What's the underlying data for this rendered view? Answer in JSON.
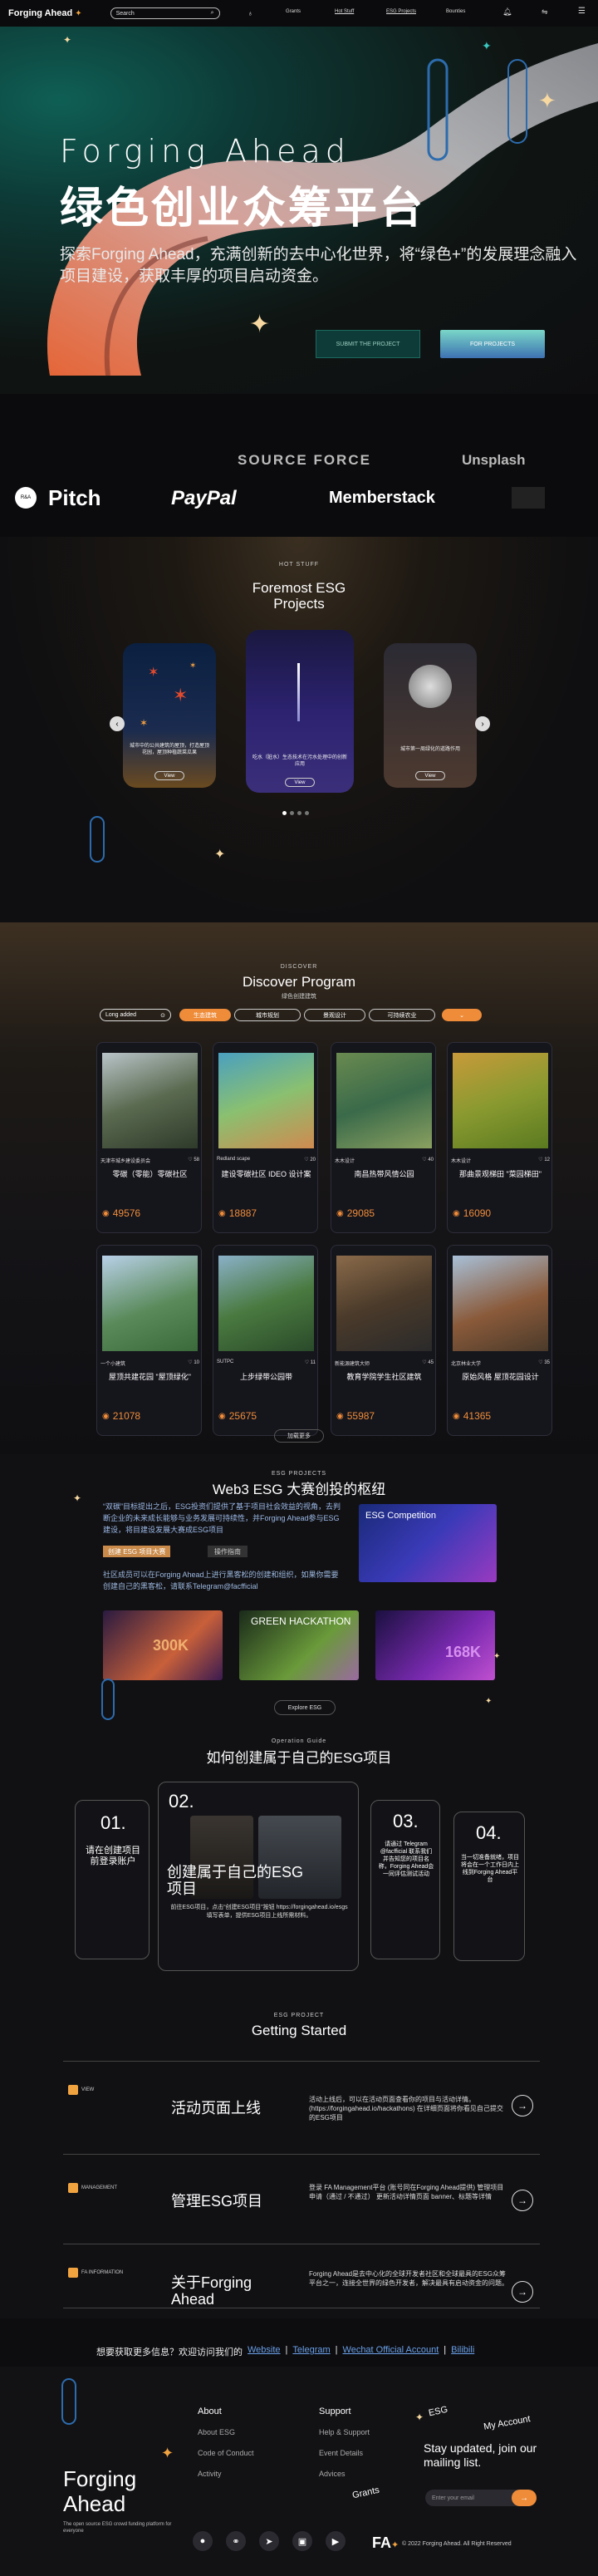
{
  "nav": {
    "logo": "Forging Ahead",
    "search_placeholder": "Search",
    "items": [
      "Grants",
      "Hot Stuff",
      "ESG Projects",
      "Bounties"
    ]
  },
  "hero": {
    "title_en": "Forging Ahead",
    "title_zh": "绿色创业众筹平台",
    "desc": "探索Forging Ahead，充满创新的去中心化世界，将“绿色+”的发展理念融入项目建设，获取丰厚的项目启动资金。",
    "btn_start": "SUBMIT THE PROJECT",
    "btn_second": "FOR PROJECTS"
  },
  "partners": {
    "row1": [
      "SOURCE FORCE",
      "Unsplash"
    ],
    "row2": [
      "Pitch",
      "PayPal",
      "Memberstack"
    ]
  },
  "hot": {
    "kicker": "HOT STUFF",
    "title": "Foremost ESG Projects",
    "cards": [
      {
        "desc": "城市中的公共建筑的屋顶，打造屋顶花园，屋顶种植蔬菜瓜果",
        "btn": "View"
      },
      {
        "desc": "吃水（脏水）生态技术在污水处理中的创新应用",
        "btn": "View"
      },
      {
        "desc": "城市第一周绿化的道路作用",
        "btn": "View"
      }
    ]
  },
  "discover": {
    "kicker": "DISCOVER",
    "title": "Discover Program",
    "subtitle": "绿色创建建筑",
    "sort": "Long added",
    "chips": [
      "生态建筑",
      "城市规划",
      "景观设计",
      "可持续农业"
    ],
    "projects": [
      {
        "author": "天津市城乡建设委员会",
        "likes": "58",
        "title": "零碳（零能）零碳社区",
        "views": "49576"
      },
      {
        "author": "Redland scape",
        "likes": "20",
        "title": "建设零碳社区 IDEO 设计案",
        "views": "18887"
      },
      {
        "author": "木木设计",
        "likes": "40",
        "title": "南昌热带风情公园",
        "views": "29085"
      },
      {
        "author": "木木设计",
        "likes": "12",
        "title": "那曲景观梯田 \"菜园梯田\"",
        "views": "16090"
      },
      {
        "author": "一个小建筑",
        "likes": "10",
        "title": "屋顶共建花园 \"屋顶绿化\"",
        "views": "21078"
      },
      {
        "author": "SUTPC",
        "likes": "11",
        "title": "上步绿带公园带",
        "views": "25675"
      },
      {
        "author": "新能源建筑大师",
        "likes": "45",
        "title": "教育学院学生社区建筑",
        "views": "55987"
      },
      {
        "author": "北京林业大学",
        "likes": "35",
        "title": "原始风格 屋顶花园设计",
        "views": "41365"
      }
    ],
    "more": "加载更多"
  },
  "esg": {
    "kicker": "ESG PROJECTS",
    "title": "Web3 ESG 大赛创投的枢纽",
    "p1": "“双碳”目标提出之后，ESG投资们提供了基于项目社会效益的视角，去判断企业的未来成长能够与业务发展可持续性，并Forging Ahead参与ESG建设，将目建设发展大赛成ESG项目",
    "tag1": "创建 ESG 项目大赛",
    "tag2": "操作指南",
    "p2": "社区成员可以在Forging Ahead上进行黑客松的创建和组织，如果你需要创建自己的黑客松，请联系Telegram@facfficial",
    "comp_title": "ESG Competition",
    "thumbs": [
      "300K",
      "GREEN HACKATHON",
      "168K"
    ],
    "btn": "Explore ESG"
  },
  "how": {
    "kicker": "Operation Guide",
    "title": "如何创建属于自己的ESG项目",
    "steps": [
      {
        "n": "01.",
        "t": "请在创建项目前登录账户"
      },
      {
        "n": "02.",
        "t": "创建属于自己的ESG项目",
        "d": "前往ESG项目，点击“创建ESG项目”按钮 https://forgingahead.io/esgs 填写表单，提供ESG项目上线所需材料。"
      },
      {
        "n": "03.",
        "t": "请通过 Telegram @facfficial 联系我们并告知您的项目名称，Forging Ahead会一同评估测试活动"
      },
      {
        "n": "04.",
        "t": "当一切准备就绪，项目将会在一个工作日内上线到Forging Ahead平台"
      }
    ]
  },
  "gs": {
    "kicker": "ESG PROJECT",
    "title": "Getting Started",
    "rows": [
      {
        "tag": "VIEW",
        "title": "活动页面上线",
        "desc": "活动上线后，可以在活动页面查看你的项目与活动详情。 (https://forgingahead.io/hackathons) 在详细页面将你看见自己提交的ESG项目"
      },
      {
        "tag": "MANAGEMENT",
        "title": "管理ESG项目",
        "desc": "登录 FA Management平台 (账号同在Forging Ahead提供) 管理项目申请（通过 / 不通过） 更新活动详情页面 banner、标题等详情"
      },
      {
        "tag": "FA INFORMATION",
        "title": "关于Forging Ahead",
        "desc": "Forging Ahead是去中心化的全球开发者社区和全球最具的ESG众筹平台之一，连接全世界的绿色开发者，解决最具有启动资金的问题。"
      }
    ],
    "more_text": "想要获取更多信息？欢迎访问我们的",
    "links": [
      "Website",
      "Telegram",
      "Wechat Official Account",
      "Bilibili"
    ]
  },
  "footer": {
    "brand": "Forging Ahead",
    "tagline": "The open source ESG crowd funding platform for everyone",
    "about": {
      "h": "About",
      "items": [
        "About ESG",
        "Code of Conduct",
        "Activity"
      ]
    },
    "support": {
      "h": "Support",
      "items": [
        "Help & Support",
        "Event Details",
        "Advices"
      ]
    },
    "floating": [
      "ESG",
      "My Account",
      "Grants"
    ],
    "stay": "Stay updated, join our mailing list.",
    "email_placeholder": "Enter your email",
    "copyright": "2022 Forging Ahead. All Right Reserved"
  },
  "colors": {
    "accent": "#f1a340",
    "teal": "#1b6a60",
    "bg": "#0d0d10"
  }
}
